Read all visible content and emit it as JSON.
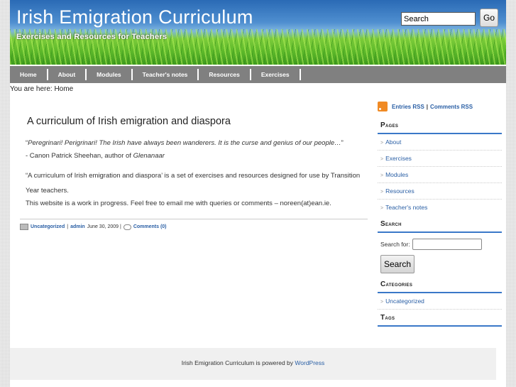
{
  "header": {
    "title": "Irish Emigration Curriculum",
    "tagline": "Exercises and Resources for Teachers",
    "search_value": "Search",
    "go_label": "Go"
  },
  "nav": [
    "Home",
    "About",
    "Modules",
    "Teacher's notes",
    "Resources",
    "Exercises"
  ],
  "breadcrumb": "You are here: Home",
  "post": {
    "title": "A curriculum of Irish emigration and diaspora",
    "quote_open": "“",
    "quote": "Peregrinari! Perigrinari! The Irish have always been wanderers. It is the curse and genius of our people…",
    "quote_close": "”",
    "attribution": "- Canon Patrick Sheehan, author of ",
    "attribution_book": "Glenanaar",
    "para1": "“A curriculum of Irish emigration and diaspora’ is a set of exercises and resources designed for use by Transition Year teachers.",
    "para2": "This website is a work in progress. Feel free to email me with queries or comments – noreen(at)ean.ie.",
    "meta": {
      "category": "Uncategorized",
      "sep": "|",
      "author": "admin",
      "date": "June 30, 2009 |",
      "comments": "Comments (0)"
    }
  },
  "sidebar": {
    "entries_rss": "Entries RSS",
    "rss_sep": "|",
    "comments_rss": "Comments RSS",
    "pages_title": "Pages",
    "pages": [
      "About",
      "Exercises",
      "Modules",
      "Resources",
      "Teacher's notes"
    ],
    "search_title": "Search",
    "search_label": "Search for:",
    "search_button": "Search",
    "categories_title": "Categories",
    "categories": [
      "Uncategorized"
    ],
    "tags_title": "Tags"
  },
  "footer": {
    "text": "Irish Emigration Curriculum is powered by ",
    "link": "WordPress"
  }
}
